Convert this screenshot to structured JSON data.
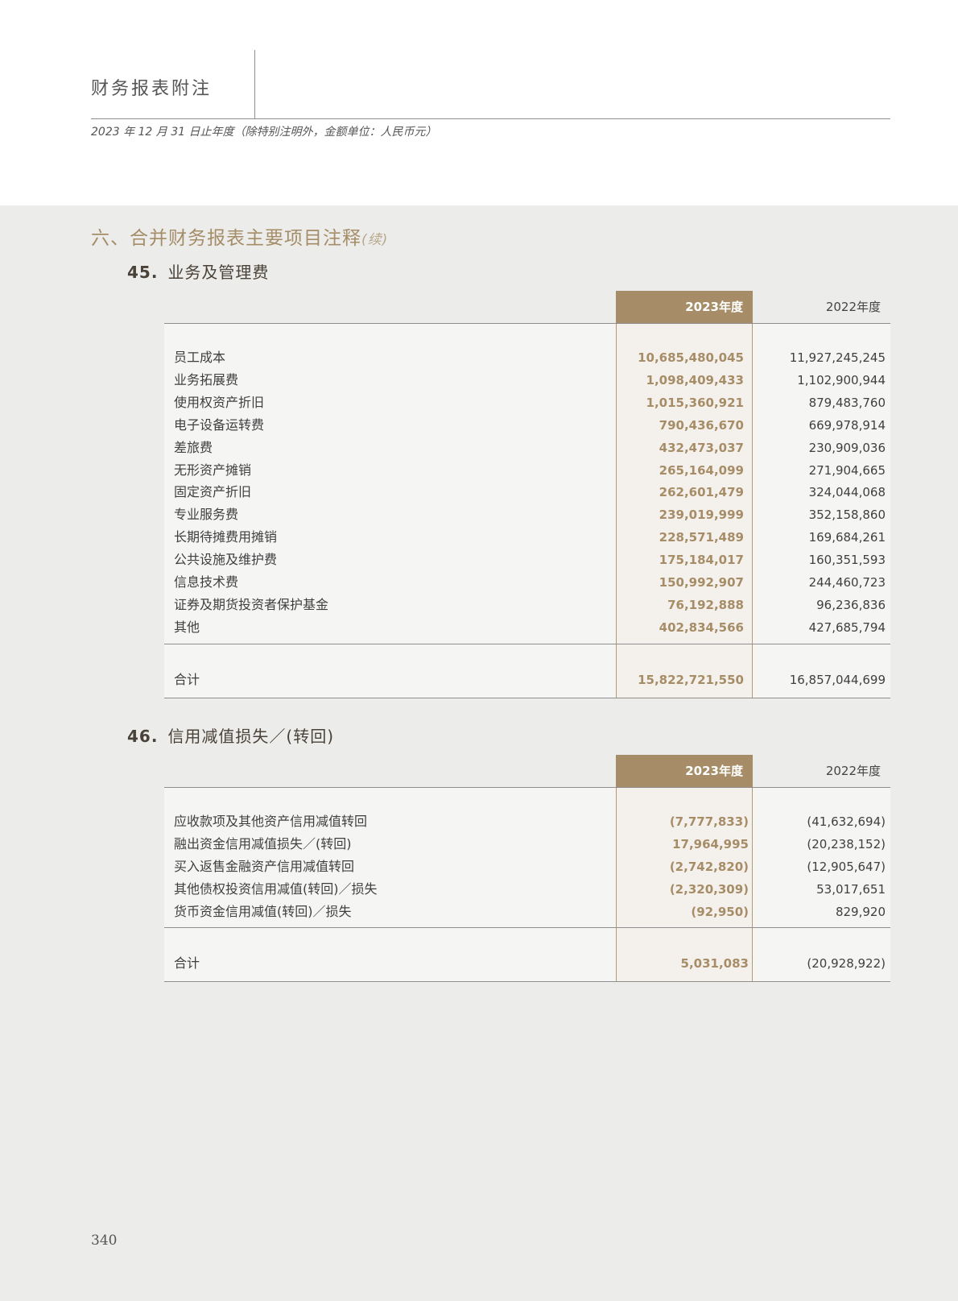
{
  "header": {
    "title": "财务报表附注",
    "subtitle": "2023 年 12 月 31 日止年度（除特别注明外，金额单位：人民币元）"
  },
  "section": {
    "title": "六、合并财务报表主要项目注释",
    "continued": "(续)"
  },
  "note45": {
    "number": "45.",
    "title": "业务及管理费",
    "col_current": "2023年度",
    "col_prior": "2022年度",
    "rows": [
      {
        "label": "员工成本",
        "v2023": "10,685,480,045",
        "v2022": "11,927,245,245"
      },
      {
        "label": "业务拓展费",
        "v2023": "1,098,409,433",
        "v2022": "1,102,900,944"
      },
      {
        "label": "使用权资产折旧",
        "v2023": "1,015,360,921",
        "v2022": "879,483,760"
      },
      {
        "label": "电子设备运转费",
        "v2023": "790,436,670",
        "v2022": "669,978,914"
      },
      {
        "label": "差旅费",
        "v2023": "432,473,037",
        "v2022": "230,909,036"
      },
      {
        "label": "无形资产摊销",
        "v2023": "265,164,099",
        "v2022": "271,904,665"
      },
      {
        "label": "固定资产折旧",
        "v2023": "262,601,479",
        "v2022": "324,044,068"
      },
      {
        "label": "专业服务费",
        "v2023": "239,019,999",
        "v2022": "352,158,860"
      },
      {
        "label": "长期待摊费用摊销",
        "v2023": "228,571,489",
        "v2022": "169,684,261"
      },
      {
        "label": "公共设施及维护费",
        "v2023": "175,184,017",
        "v2022": "160,351,593"
      },
      {
        "label": "信息技术费",
        "v2023": "150,992,907",
        "v2022": "244,460,723"
      },
      {
        "label": "证券及期货投资者保护基金",
        "v2023": "76,192,888",
        "v2022": "96,236,836"
      },
      {
        "label": "其他",
        "v2023": "402,834,566",
        "v2022": "427,685,794"
      }
    ],
    "total": {
      "label": "合计",
      "v2023": "15,822,721,550",
      "v2022": "16,857,044,699"
    }
  },
  "note46": {
    "number": "46.",
    "title": "信用减值损失／(转回)",
    "col_current": "2023年度",
    "col_prior": "2022年度",
    "rows": [
      {
        "label": "应收款项及其他资产信用减值转回",
        "v2023": "(7,777,833)",
        "v2022": "(41,632,694)"
      },
      {
        "label": "融出资金信用减值损失／(转回)",
        "v2023": "17,964,995",
        "v2022": "(20,238,152)"
      },
      {
        "label": "买入返售金融资产信用减值转回",
        "v2023": "(2,742,820)",
        "v2022": "(12,905,647)"
      },
      {
        "label": "其他债权投资信用减值(转回)／损失",
        "v2023": "(2,320,309)",
        "v2022": "53,017,651"
      },
      {
        "label": "货币资金信用减值(转回)／损失",
        "v2023": "(92,950)",
        "v2022": "829,920"
      }
    ],
    "total": {
      "label": "合计",
      "v2023": "5,031,083",
      "v2022": "(20,928,922)"
    }
  },
  "page_number": "340"
}
